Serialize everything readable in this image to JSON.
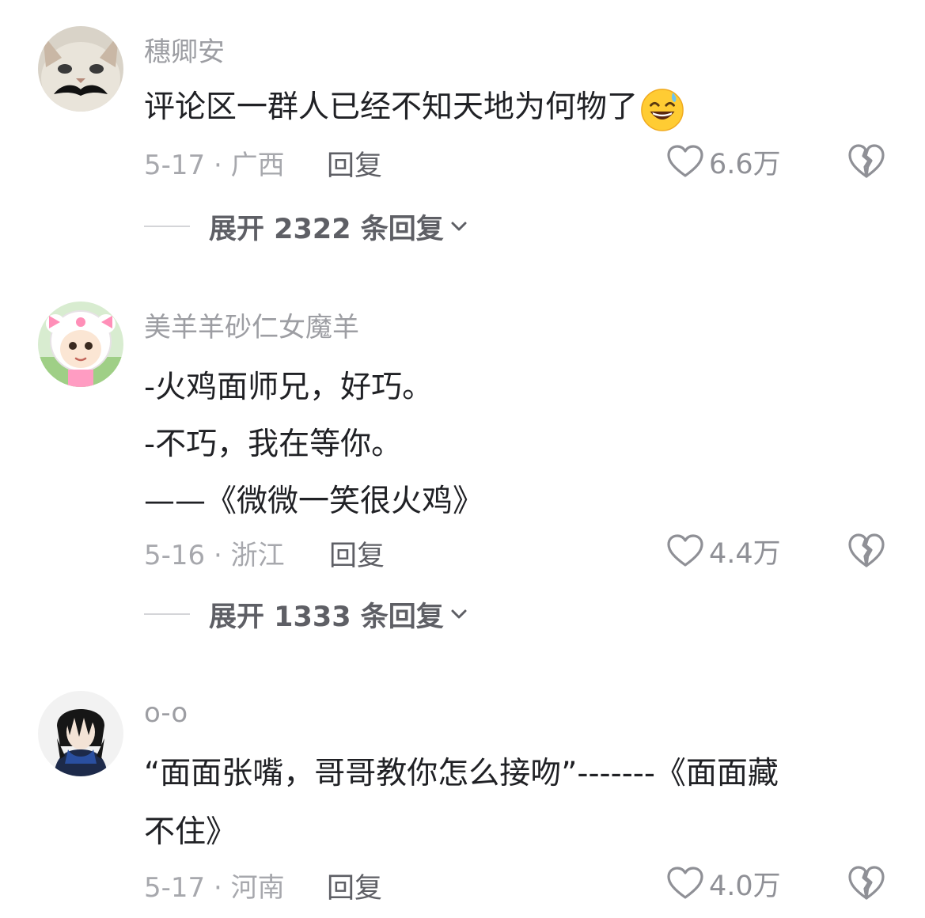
{
  "comments": [
    {
      "username": "穗卿安",
      "lines": [
        "评论区一群人已经不知天地为何物了"
      ],
      "inline_emoji": "grinning-sweat-emoji",
      "date_location": "5-17 · 广西",
      "reply_label": "回复",
      "likes": "6.6万",
      "expand_label": "展开 2322 条回复"
    },
    {
      "username": "美羊羊砂仁女魔羊",
      "lines": [
        "-火鸡面师兄，好巧。",
        "-不巧，我在等你。",
        "——《微微一笑很火鸡》"
      ],
      "date_location": "5-16 · 浙江",
      "reply_label": "回复",
      "likes": "4.4万",
      "expand_label": "展开 1333 条回复"
    },
    {
      "username": "o-o",
      "lines": [
        "“面面张嘴，哥哥教你怎么接吻”-------《面面藏",
        "不住》"
      ],
      "date_location": "5-17 · 河南",
      "reply_label": "回复",
      "likes": "4.0万"
    }
  ],
  "colors": {
    "username": "#9d9ea3",
    "body_text": "#202125",
    "meta": "#a7a8ad",
    "action": "#5e5f65",
    "icon_stroke": "#8f9096"
  }
}
